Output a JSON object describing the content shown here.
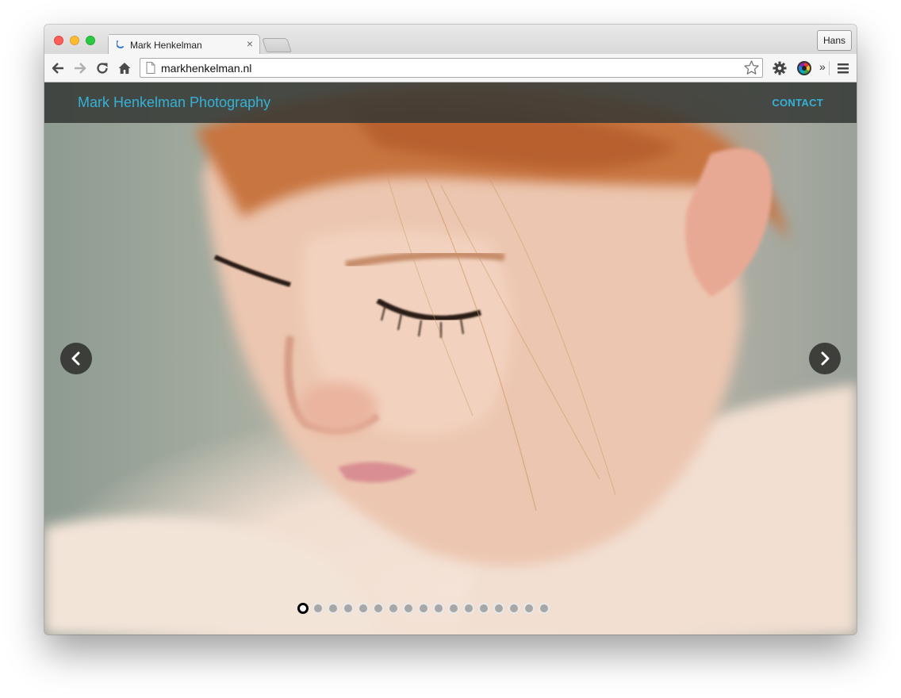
{
  "browser": {
    "tab_title": "Mark Henkelman",
    "tab_close": "×",
    "profile_name": "Hans",
    "url": "markhenkelman.nl",
    "overflow_chevron": "»"
  },
  "site": {
    "title": "Mark Henkelman Photography",
    "nav_contact": "CONTACT"
  },
  "slider": {
    "total_slides": 17,
    "active_index": 0
  },
  "colors": {
    "brand_link": "#34b2d6",
    "header_bg": "#343734"
  },
  "icons": [
    "back-icon",
    "forward-icon",
    "reload-icon",
    "home-icon",
    "page-icon",
    "bookmark-star-icon",
    "settings-gear-icon",
    "color-extension-icon",
    "menu-icon",
    "prev-arrow-icon",
    "next-arrow-icon"
  ]
}
